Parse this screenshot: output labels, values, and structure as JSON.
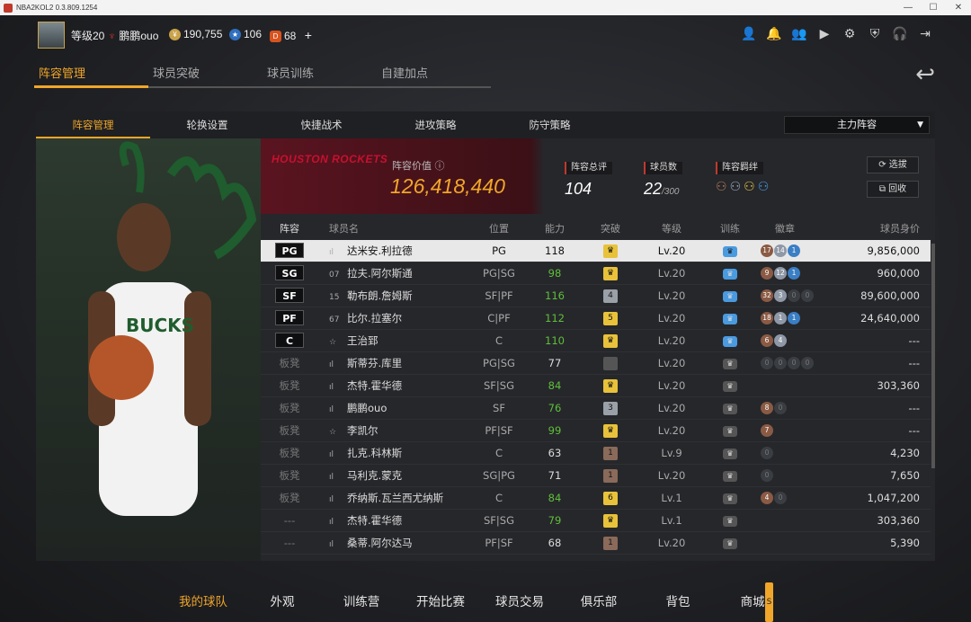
{
  "window": {
    "title": "NBA2KOL2 0.3.809.1254"
  },
  "header": {
    "level": "等级20",
    "username": "鹏鹏ouo",
    "coins": "190,755",
    "stars": "106",
    "tokens": "68",
    "plus": "+"
  },
  "top_tabs": [
    "阵容管理",
    "球员突破",
    "球员训练",
    "自建加点"
  ],
  "sub_tabs": [
    "阵容管理",
    "轮换设置",
    "快捷战术",
    "进攻策略",
    "防守策略"
  ],
  "lineup_select": "主力阵容",
  "team": {
    "logo_text": "HOUSTON ROCKETS",
    "value_label": "阵容价值",
    "value": "126,418,440",
    "rating_label": "阵容总评",
    "rating": "104",
    "count_label": "球员数",
    "count": "22",
    "count_max": "/300",
    "bond_label": "阵容羁绊",
    "btn_pick": "选拔",
    "btn_recycle": "回收"
  },
  "table": {
    "headers": [
      "阵容",
      "球员名",
      "位置",
      "能力",
      "突破",
      "等级",
      "训练",
      "徽章",
      "球员身价"
    ],
    "rows": [
      {
        "slot": "PG",
        "num": "",
        "name": "达米安.利拉德",
        "pos": "PG",
        "ability": "118",
        "brk": "♛",
        "lvl": "Lv.20",
        "badges": [
          "17",
          "14",
          "1"
        ],
        "value": "9,856,000"
      },
      {
        "slot": "SG",
        "num": "07",
        "name": "拉夫.阿尔斯通",
        "pos": "PG|SG",
        "ability": "98",
        "brk": "♛",
        "lvl": "Lv.20",
        "badges": [
          "9",
          "12",
          "1"
        ],
        "value": "960,000"
      },
      {
        "slot": "SF",
        "num": "15",
        "name": "勒布朗.詹姆斯",
        "pos": "SF|PF",
        "ability": "116",
        "brk": "4",
        "lvl": "Lv.20",
        "badges": [
          "32",
          "3",
          "0",
          "0"
        ],
        "value": "89,600,000"
      },
      {
        "slot": "PF",
        "num": "67",
        "name": "比尔.拉塞尔",
        "pos": "C|PF",
        "ability": "112",
        "brk": "5",
        "lvl": "Lv.20",
        "badges": [
          "18",
          "1",
          "1"
        ],
        "value": "24,640,000"
      },
      {
        "slot": "C",
        "num": "☆",
        "name": "王治郅",
        "pos": "C",
        "ability": "110",
        "brk": "♛",
        "lvl": "Lv.20",
        "badges": [
          "6",
          "4"
        ],
        "value": "---"
      },
      {
        "slot": "板凳",
        "num": "",
        "name": "斯蒂芬.库里",
        "pos": "PG|SG",
        "ability": "77",
        "brk": "",
        "lvl": "Lv.20",
        "badges": [
          "0",
          "0",
          "0",
          "0"
        ],
        "value": "---"
      },
      {
        "slot": "板凳",
        "num": "",
        "name": "杰特.霍华德",
        "pos": "SF|SG",
        "ability": "84",
        "brk": "♛",
        "lvl": "Lv.20",
        "badges": [],
        "value": "303,360"
      },
      {
        "slot": "板凳",
        "num": "",
        "name": "鹏鹏ouo",
        "pos": "SF",
        "ability": "76",
        "brk": "3",
        "lvl": "Lv.20",
        "badges": [
          "8",
          "0"
        ],
        "value": "---"
      },
      {
        "slot": "板凳",
        "num": "☆",
        "name": "李凯尔",
        "pos": "PF|SF",
        "ability": "99",
        "brk": "♛",
        "lvl": "Lv.20",
        "badges": [
          "7"
        ],
        "value": "---"
      },
      {
        "slot": "板凳",
        "num": "",
        "name": "扎克.科林斯",
        "pos": "C",
        "ability": "63",
        "brk": "1",
        "lvl": "Lv.9",
        "badges": [
          "0"
        ],
        "value": "4,230"
      },
      {
        "slot": "板凳",
        "num": "",
        "name": "马利克.蒙克",
        "pos": "SG|PG",
        "ability": "71",
        "brk": "1",
        "lvl": "Lv.20",
        "badges": [
          "0"
        ],
        "value": "7,650"
      },
      {
        "slot": "板凳",
        "num": "",
        "name": "乔纳斯.瓦兰西尤纳斯",
        "pos": "C",
        "ability": "84",
        "brk": "6",
        "lvl": "Lv.1",
        "badges": [
          "4",
          "0"
        ],
        "value": "1,047,200"
      },
      {
        "slot": "---",
        "num": "",
        "name": "杰特.霍华德",
        "pos": "SF|SG",
        "ability": "79",
        "brk": "♛",
        "lvl": "Lv.1",
        "badges": [],
        "value": "303,360"
      },
      {
        "slot": "---",
        "num": "",
        "name": "桑蒂.阿尔达马",
        "pos": "PF|SF",
        "ability": "68",
        "brk": "1",
        "lvl": "Lv.20",
        "badges": [],
        "value": "5,390"
      }
    ]
  },
  "bottom_nav": [
    "我的球队",
    "外观",
    "训练营",
    "开始比赛",
    "球员交易",
    "俱乐部",
    "背包",
    "商城"
  ],
  "colors": {
    "accent": "#f0a62a",
    "green": "#5fbf3a",
    "selected_row": "#e8e8e8"
  }
}
